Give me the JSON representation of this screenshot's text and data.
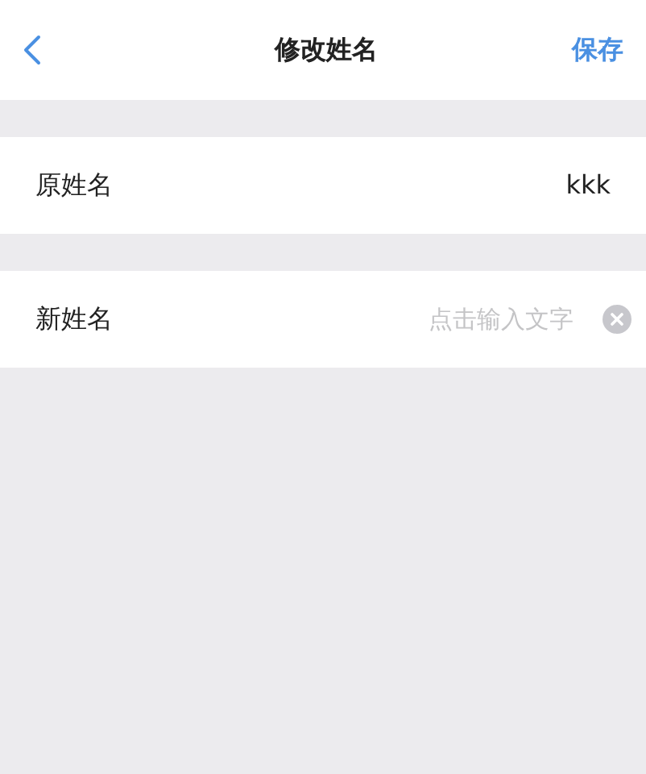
{
  "header": {
    "title": "修改姓名",
    "action": "保存"
  },
  "original": {
    "label": "原姓名",
    "value": "kkk"
  },
  "new_name": {
    "label": "新姓名",
    "placeholder": "点击输入文字"
  }
}
